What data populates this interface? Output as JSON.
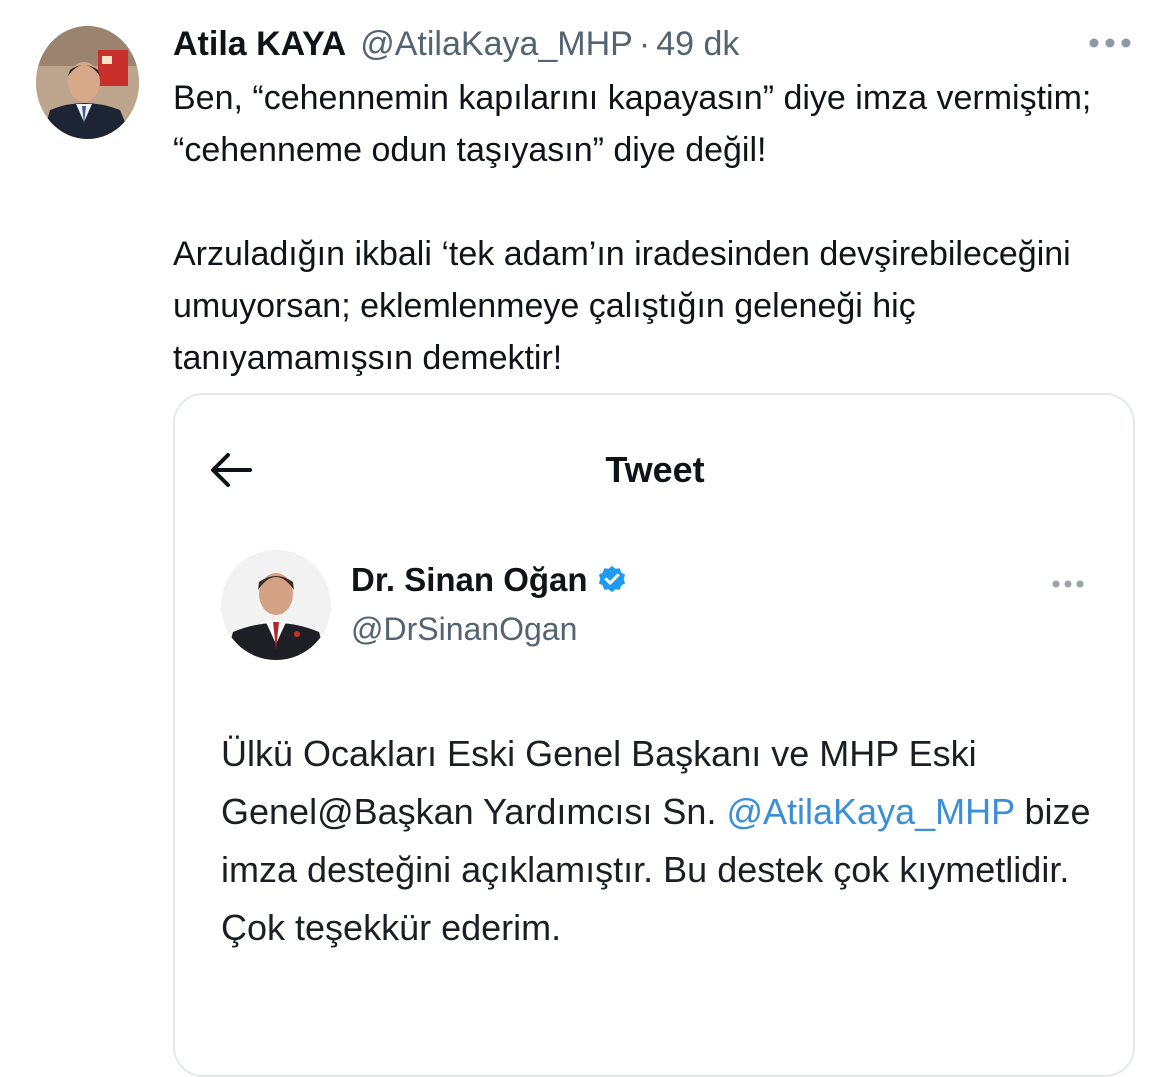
{
  "tweet": {
    "author_name": "Atila KAYA",
    "author_handle": "@AtilaKaya_MHP",
    "separator": "·",
    "time": "49 dk",
    "more_icon": "more-horizontal-icon",
    "paragraphs": [
      "Ben, “cehennemin kapılarını kapayasın” diye imza vermiştim; “cehenneme odun taşıyasın” diye değil!",
      "Arzuladığın ikbali ‘tek adam’ın iradesinden devşirebileceğini umuyorsan; eklemlenmeye çalıştığın geleneği hiç tanıyamamışsın demektir!"
    ]
  },
  "attached_screenshot": {
    "header_title": "Tweet",
    "back_icon": "arrow-left-icon",
    "quoted": {
      "author_name": "Dr. Sinan Oğan",
      "verified_icon": "verified-badge-icon",
      "author_handle": "@DrSinanOgan",
      "text_before_mention": "Ülkü Ocakları Eski Genel Başkanı ve MHP Eski Genel@Başkan Yardımcısı Sn.",
      "mention": "@AtilaKaya_MHP",
      "text_after_mention": " bize imza desteğini açıklamıştır. Bu destek çok kıymetlidir. Çok teşekkür ederim."
    }
  },
  "colors": {
    "text": "#0f1419",
    "secondary": "#536471",
    "link": "#3b8fd6",
    "verified": "#1d9bf0",
    "border": "#e6e9ec"
  }
}
